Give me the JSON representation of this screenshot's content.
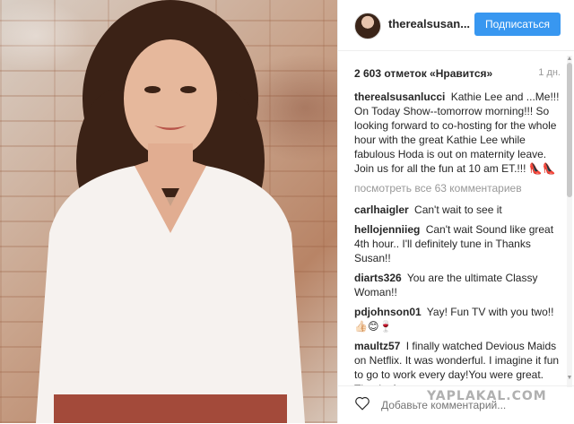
{
  "post": {
    "username": "therealsusan...",
    "follow_label": "Подписаться",
    "likes": "2 603 отметок «Нравится»",
    "time_ago": "1 дн."
  },
  "caption": {
    "user": "therealsusanlucci",
    "text": "Kathie Lee and ...Me!!! On Today Show--tomorrow morning!!! So looking forward to co-hosting for the whole hour with the great Kathie Lee while fabulous Hoda is out on maternity leave. Join us for all the fun at 10 am ET.!!!",
    "emoji": "👠👠"
  },
  "view_all": "посмотреть все 63 комментариев",
  "comments": [
    {
      "user": "carlhaigler",
      "text": "Can't wait to see it"
    },
    {
      "user": "hellojenniieg",
      "text": "Can't wait Sound like great 4th hour.. I'll definitely tune in Thanks Susan!!"
    },
    {
      "user": "diarts326",
      "text": "You are the ultimate Classy Woman!!"
    },
    {
      "user": "pdjohnson01",
      "text": "Yay! Fun TV with you two!! 👍🏻😊🍷"
    },
    {
      "user": "maultz57",
      "text": "I finally watched Devious Maids on Netflix. It was wonderful. I imagine it fun to go to work every day!You were great. Thanks for many"
    }
  ],
  "footer": {
    "comment_placeholder": "Добавьте комментарий..."
  },
  "watermark": "YAPLAKAL.COM",
  "colors": {
    "accent": "#3897f0",
    "muted": "#999999"
  }
}
